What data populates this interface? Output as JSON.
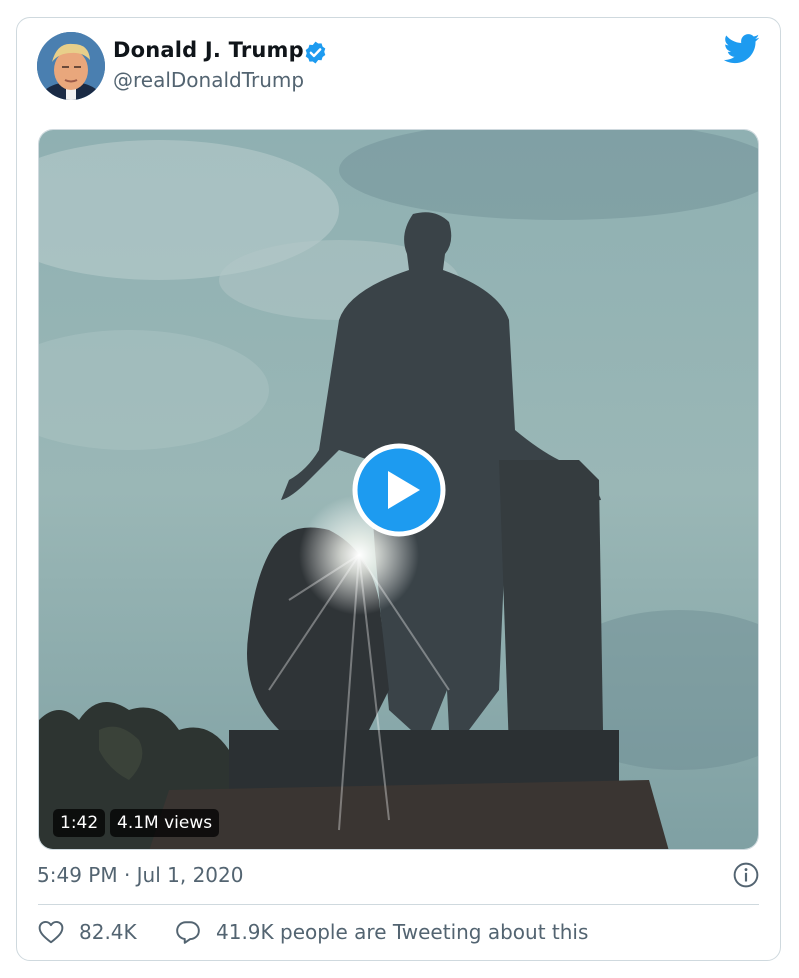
{
  "tweet": {
    "author_name": "Donald J. Trump",
    "handle": "@realDonaldTrump",
    "timestamp": "5:49 PM · Jul 1, 2020",
    "likes": "82.4K",
    "discussion_text": "41.9K people are Tweeting about this"
  },
  "video": {
    "duration": "1:42",
    "views": "4.1M views"
  },
  "icons": {
    "verified": "verified-badge-icon",
    "brand": "twitter-bird-icon",
    "play": "play-icon",
    "info": "info-icon",
    "like": "heart-icon",
    "reply": "speech-bubble-icon"
  },
  "colors": {
    "accent": "#1d9bf0",
    "secondary_text": "#536471",
    "border": "#cfd9de"
  }
}
